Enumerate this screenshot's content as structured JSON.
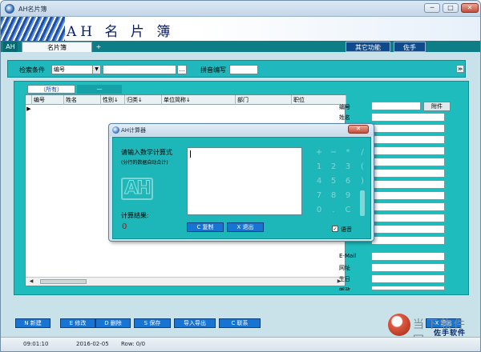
{
  "window": {
    "title": "AH名片簿",
    "min": "─",
    "max": "□",
    "close": "✕"
  },
  "banner": {
    "logo": "AH 名 片 簿"
  },
  "tabs": {
    "ah": "AH",
    "card": "名片簿",
    "plus": "+",
    "other": "其它功能",
    "helper": "佐手"
  },
  "search": {
    "label": "检索条件",
    "field_value": "编号",
    "btn": "…",
    "pinyin_label": "拼音编写",
    "chevron": "≫"
  },
  "subtabs": {
    "all": "（所有）",
    "dash": "—"
  },
  "grid": {
    "columns": [
      "编号",
      "姓名",
      "性别↓",
      "归类↓",
      "单位简称↓",
      "部门",
      "职位"
    ],
    "row_indicator": "▶"
  },
  "scroll": {
    "left": "◀",
    "right": "▶"
  },
  "fields": [
    "编号",
    "姓名",
    "E-Mail",
    "网址",
    "生日",
    "邮政"
  ],
  "attach_btn": "附件",
  "dialog": {
    "title": "AH计算器",
    "close": "✕",
    "prompt": "请输入数学计算式",
    "note": "(分行的数据自动合计)",
    "ah_logo": "AH",
    "result_label": "计算结果:",
    "result_value": "0",
    "copy_btn": "C 复制",
    "exit_btn": "X 退出",
    "voice": "语音",
    "voice_checked": "✓",
    "keys": [
      "+",
      "−",
      "*",
      "/",
      "1",
      "2",
      "3",
      "(",
      "4",
      "5",
      "6",
      ")",
      "7",
      "8",
      "9",
      "0",
      ".",
      "C"
    ]
  },
  "bottom": {
    "new": "N 新建",
    "edit": "E 修改",
    "delete": "D 删除",
    "save": "S 保存",
    "import": "导入导出",
    "contact": "C 联系",
    "exit": "X 退出",
    "helper": "佐手软件"
  },
  "status": {
    "time": "09:01:10",
    "date": "2016-02-05",
    "row": "Row: 0/0"
  },
  "watermark": "当下软件园"
}
